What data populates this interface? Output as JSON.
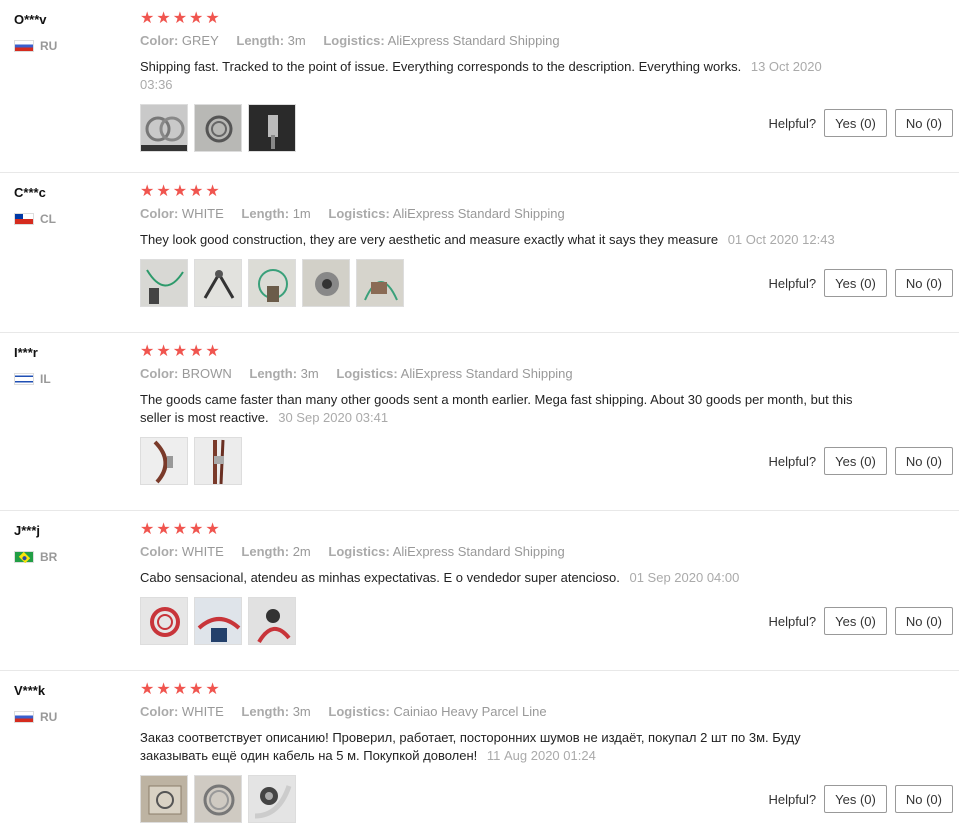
{
  "colors": {
    "star": "#f0554f",
    "muted": "#999999"
  },
  "helpful_label": "Helpful?",
  "reviews": [
    {
      "user": "O***v",
      "country": "RU",
      "color_label": "Color:",
      "color": "GREY",
      "length_label": "Length:",
      "length": "3m",
      "logistics_label": "Logistics:",
      "logistics": "AliExpress Standard Shipping",
      "text": "Shipping fast. Tracked to the point of issue. Everything corresponds to the description. Everything works.",
      "date": "13 Oct 2020 03:36",
      "yes": "Yes (0)",
      "no": "No (0)"
    },
    {
      "user": "C***c",
      "country": "CL",
      "color_label": "Color:",
      "color": "WHITE",
      "length_label": "Length:",
      "length": "1m",
      "logistics_label": "Logistics:",
      "logistics": "AliExpress Standard Shipping",
      "text": "They look good construction, they are very aesthetic and measure exactly what it says they measure",
      "date": "01 Oct 2020 12:43",
      "yes": "Yes (0)",
      "no": "No (0)"
    },
    {
      "user": "I***r",
      "country": "IL",
      "color_label": "Color:",
      "color": "BROWN",
      "length_label": "Length:",
      "length": "3m",
      "logistics_label": "Logistics:",
      "logistics": "AliExpress Standard Shipping",
      "text": "The goods came faster than many other goods sent a month earlier. Mega fast shipping. About 30 goods per month, but this seller is most reactive.",
      "date": "30 Sep 2020 03:41",
      "yes": "Yes (0)",
      "no": "No (0)"
    },
    {
      "user": "J***j",
      "country": "BR",
      "color_label": "Color:",
      "color": "WHITE",
      "length_label": "Length:",
      "length": "2m",
      "logistics_label": "Logistics:",
      "logistics": "AliExpress Standard Shipping",
      "text": "Cabo sensacional, atendeu as minhas expectativas. E o vendedor super atencioso.",
      "date": "01 Sep 2020 04:00",
      "yes": "Yes (0)",
      "no": "No (0)"
    },
    {
      "user": "V***k",
      "country": "RU",
      "color_label": "Color:",
      "color": "WHITE",
      "length_label": "Length:",
      "length": "3m",
      "logistics_label": "Logistics:",
      "logistics": "Cainiao Heavy Parcel Line",
      "text": "Заказ соответствует описанию! Проверил, работает, посторонних шумов не издаёт, покупал 2 шт по 3м. Буду заказывать ещё один кабель на 5 м. Покупкой доволен!",
      "date": "11 Aug 2020 01:24",
      "yes": "Yes (0)",
      "no": "No (0)"
    }
  ]
}
